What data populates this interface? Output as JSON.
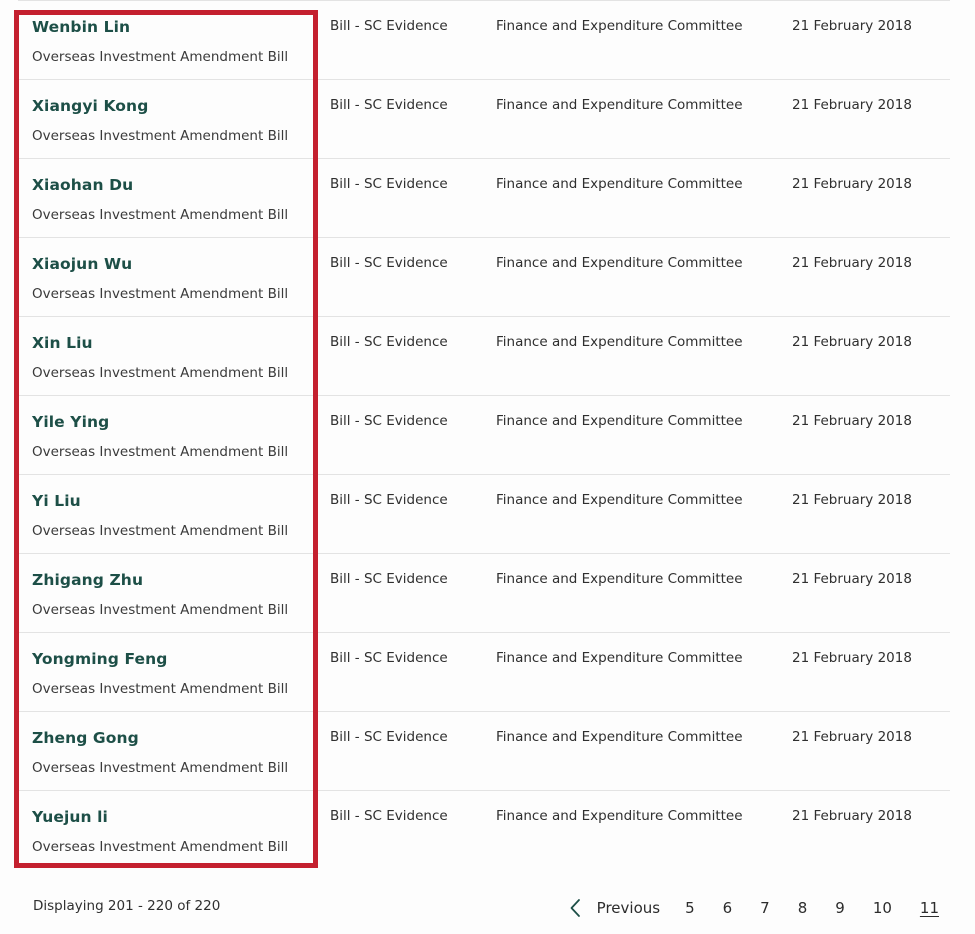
{
  "table": {
    "rows": [
      {
        "name": "Wenbin Lin",
        "subtitle": "Overseas Investment Amendment Bill",
        "type": "Bill - SC Evidence",
        "committee": "Finance and Expenditure Committee",
        "date": "21 February 2018"
      },
      {
        "name": "Xiangyi Kong",
        "subtitle": "Overseas Investment Amendment Bill",
        "type": "Bill - SC Evidence",
        "committee": "Finance and Expenditure Committee",
        "date": "21 February 2018"
      },
      {
        "name": "Xiaohan Du",
        "subtitle": "Overseas Investment Amendment Bill",
        "type": "Bill - SC Evidence",
        "committee": "Finance and Expenditure Committee",
        "date": "21 February 2018"
      },
      {
        "name": "Xiaojun Wu",
        "subtitle": "Overseas Investment Amendment Bill",
        "type": "Bill - SC Evidence",
        "committee": "Finance and Expenditure Committee",
        "date": "21 February 2018"
      },
      {
        "name": "Xin Liu",
        "subtitle": "Overseas Investment Amendment Bill",
        "type": "Bill - SC Evidence",
        "committee": "Finance and Expenditure Committee",
        "date": "21 February 2018"
      },
      {
        "name": "Yile Ying",
        "subtitle": "Overseas Investment Amendment Bill",
        "type": "Bill - SC Evidence",
        "committee": "Finance and Expenditure Committee",
        "date": "21 February 2018"
      },
      {
        "name": "Yi Liu",
        "subtitle": "Overseas Investment Amendment Bill",
        "type": "Bill - SC Evidence",
        "committee": "Finance and Expenditure Committee",
        "date": "21 February 2018"
      },
      {
        "name": "Zhigang Zhu",
        "subtitle": "Overseas Investment Amendment Bill",
        "type": "Bill - SC Evidence",
        "committee": "Finance and Expenditure Committee",
        "date": "21 February 2018"
      },
      {
        "name": "Yongming Feng",
        "subtitle": "Overseas Investment Amendment Bill",
        "type": "Bill - SC Evidence",
        "committee": "Finance and Expenditure Committee",
        "date": "21 February 2018"
      },
      {
        "name": "Zheng Gong",
        "subtitle": "Overseas Investment Amendment Bill",
        "type": "Bill - SC Evidence",
        "committee": "Finance and Expenditure Committee",
        "date": "21 February 2018"
      },
      {
        "name": "Yuejun li",
        "subtitle": "Overseas Investment Amendment Bill",
        "type": "Bill - SC Evidence",
        "committee": "Finance and Expenditure Committee",
        "date": "21 February 2018"
      }
    ]
  },
  "footer": {
    "displaying": "Displaying 201 - 220 of 220"
  },
  "pagination": {
    "previous_icon": "chevron-left-icon",
    "previous_label": "Previous",
    "pages": [
      "5",
      "6",
      "7",
      "8",
      "9",
      "10",
      "11"
    ],
    "current_page": "11"
  },
  "annotation": {
    "color": "#c4202f"
  },
  "colors": {
    "link": "#1d4f47",
    "text": "#2f2f2f",
    "separator": "#e3e3e3",
    "background": "#fdfdfd",
    "annotation": "#c4202f"
  }
}
